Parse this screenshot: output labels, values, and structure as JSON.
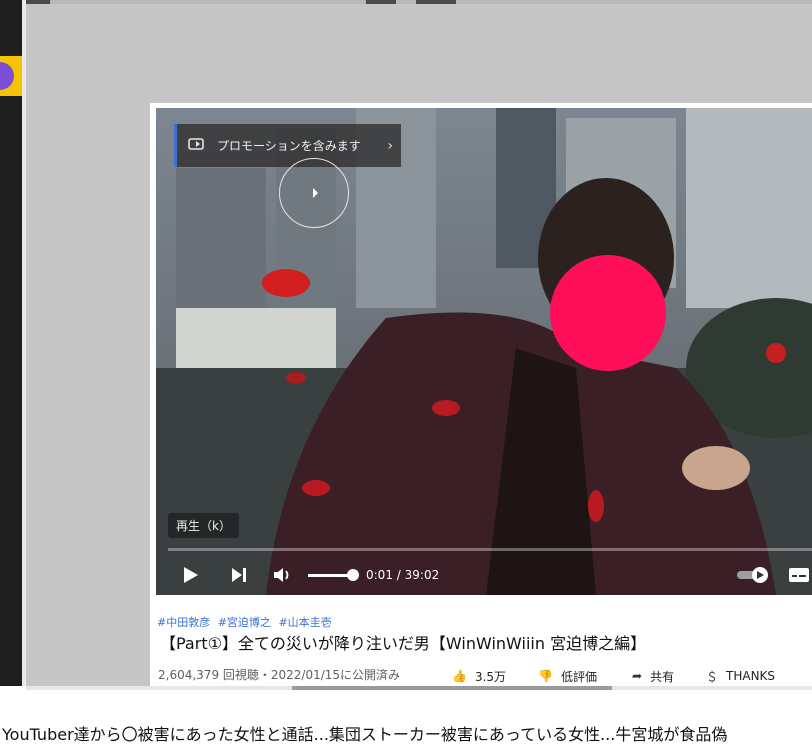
{
  "video": {
    "promo_label": "プロモーションを含みます",
    "tooltip": "再生（k）",
    "time_current": "0:01",
    "time_total": "39:02",
    "progress_fraction": 0.0004,
    "volume_fraction": 0.9
  },
  "info": {
    "hashtags": [
      "#中田敦彦",
      "#宮迫博之",
      "#山本圭壱"
    ],
    "title": "【Part①】全ての災いが降り注いだ男【WinWinWiiin 宮迫博之編】",
    "meta": "2,604,379 回視聴・2022/01/15に公開済み",
    "likes": "3.5万",
    "dislike_label": "低評価",
    "share_label": "共有",
    "thanks_label": "THANKS"
  },
  "ticker": {
    "text": "名YouTuber達から〇被害にあった女性と通話...集団ストーカー被害にあっている女性...牛宮城が食品偽"
  },
  "colors": {
    "accent_blue": "#3e6fd8",
    "face_cover": "#ff0f5a",
    "frame_gray": "#c6c6c6"
  }
}
